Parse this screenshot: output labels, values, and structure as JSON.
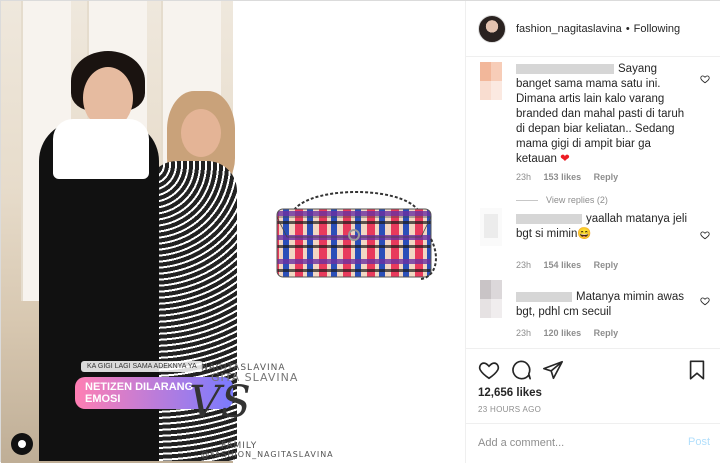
{
  "header": {
    "username": "fashion_nagitaslavina",
    "separator": "•",
    "follow_status": "Following"
  },
  "media": {
    "sticker_small": "KA GIGI LAGI SAMA ADEKNYA YA",
    "sticker_main": "NETIZEN DILARANG EMOSI",
    "watermark": {
      "line1": "NAGITASLAVINA",
      "line2": "GITA SLAVINA",
      "mark": "VS",
      "line3": "FAMILY",
      "line4": "@FASHION_NAGITASLAVINA"
    }
  },
  "comments": [
    {
      "text": "Sayang banget sama mama satu ini. Dimana artis lain kalo varang branded dan mahal pasti di taruh di depan biar keliatan.. Sedang mama gigi di ampit biar ga ketauan",
      "emoji": "❤",
      "time": "23h",
      "likes": "153 likes",
      "reply": "Reply",
      "view_replies": "View replies (2)"
    },
    {
      "text": "yaallah matanya jeli bgt si mimin",
      "emoji": "😄",
      "time": "23h",
      "likes": "154 likes",
      "reply": "Reply"
    },
    {
      "text": "Matanya mimin awas bgt, pdhl cm secuil",
      "time": "23h",
      "likes": "120 likes",
      "reply": "Reply"
    }
  ],
  "post": {
    "likes": "12,656 likes",
    "time_ago": "23 HOURS AGO"
  },
  "composer": {
    "placeholder": "Add a comment...",
    "post_label": "Post"
  },
  "colors": {
    "heart_red": "#ed4956",
    "meta_gray": "#8e8e8e",
    "post_disabled": "#b2dffc"
  }
}
